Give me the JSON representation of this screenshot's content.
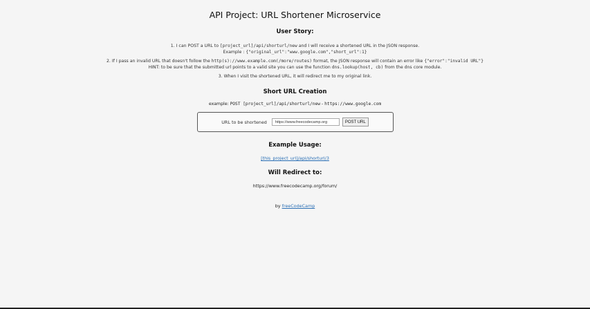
{
  "header": {
    "title": "API Project: URL Shortener Microservice"
  },
  "user_story": {
    "heading": "User Story:",
    "item1_pre": "1. I can POST a URL to ",
    "item1_code": "[project_url]/api/shorturl/new",
    "item1_post": " and I will receive a shortened URL in the JSON response.",
    "item1_example_label": "Example : ",
    "item1_example_code": "{\"original_url\":\"www.google.com\",\"short_url\":1}",
    "item2_pre": "2. If I pass an invalid URL that doesn't follow the ",
    "item2_code": "http(s)://www.example.com(/more/routes)",
    "item2_mid": " format, the JSON response will contain an error like ",
    "item2_error_code": "{\"error\":\"invalid URL\"}",
    "item2_hint_pre": "HINT: to be sure that the submitted url points to a valid site you can use the function ",
    "item2_hint_code": "dns.lookup(host, cb)",
    "item2_hint_mid": " from the ",
    "item2_hint_code2": "dns",
    "item2_hint_post": " core module.",
    "item3": "3. When I visit the shortened URL, it will redirect me to my original link."
  },
  "creation": {
    "heading": "Short URL Creation",
    "example_pre": "example: ",
    "example_code": "POST [project_url]/api/shorturl/new",
    "example_sep": " - ",
    "example_url": "https://www.google.com"
  },
  "form": {
    "label": "URL to be shortened",
    "input_value": "https://www.freecodecamp.org",
    "button_label": "POST URL"
  },
  "usage": {
    "heading": "Example Usage:",
    "link_text": "[this_project_url]/api/shorturl/3"
  },
  "redirect": {
    "heading": "Will Redirect to:",
    "url": "https://www.freecodecamp.org/forum/"
  },
  "footer": {
    "by": "by ",
    "link_text": "freeCodeCamp"
  }
}
